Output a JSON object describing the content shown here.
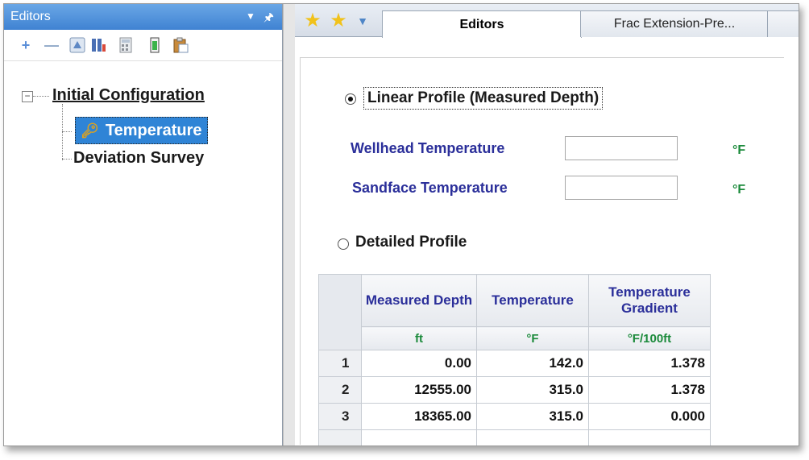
{
  "editors_panel": {
    "title": "Editors",
    "toolbar": {
      "plus_label": "+",
      "minus_label": "—"
    },
    "tree": {
      "expander": "−",
      "root": "Initial Configuration",
      "children": [
        "Temperature",
        "Deviation Survey"
      ]
    }
  },
  "tabs": {
    "active": "Editors",
    "frac": "Frac Extension-Pre..."
  },
  "form": {
    "linear_profile_label": "Linear Profile (Measured Depth)",
    "linear_selected": true,
    "wellhead_label": "Wellhead Temperature",
    "wellhead_value": "",
    "wellhead_unit": "°F",
    "sandface_label": "Sandface Temperature",
    "sandface_value": "",
    "sandface_unit": "°F",
    "detailed_profile_label": "Detailed Profile"
  },
  "table": {
    "headers": [
      "Measured Depth",
      "Temperature",
      "Temperature Gradient"
    ],
    "units": [
      "ft",
      "°F",
      "°F/100ft"
    ],
    "rows": [
      [
        "1",
        "0.00",
        "142.0",
        "1.378"
      ],
      [
        "2",
        "12555.00",
        "315.0",
        "1.378"
      ],
      [
        "3",
        "18365.00",
        "315.0",
        "0.000"
      ]
    ]
  },
  "colors": {
    "label_blue": "#2b2f9a",
    "unit_green": "#1b8a3b",
    "selection_blue": "#2f84d6"
  }
}
